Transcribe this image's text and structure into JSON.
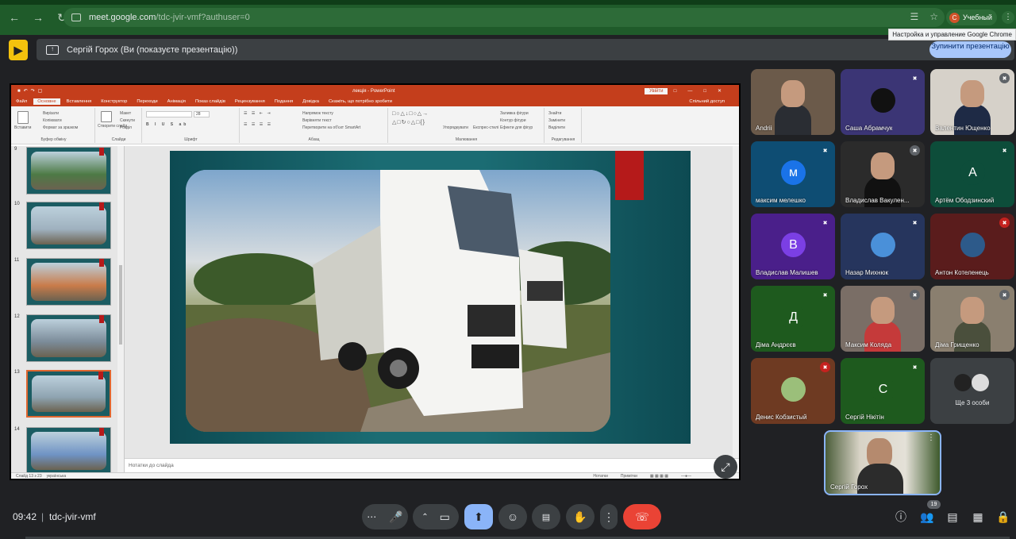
{
  "browser": {
    "url_domain": "meet.google.com",
    "url_path": "/tdc-jvir-vmf?authuser=0",
    "profile_initial": "С",
    "profile_name": "Учебный",
    "tooltip": "Настройка и управление Google Chrome"
  },
  "banner": {
    "text": "Сергій Горох (Ви (показуєте презентацію))",
    "stop_button": "Зупинити презентацію"
  },
  "powerpoint": {
    "window_title": "лекція - PowerPoint",
    "login_button": "Увійти",
    "menu": [
      "Файл",
      "Основне",
      "Вставлення",
      "Конструктор",
      "Переходи",
      "Анімація",
      "Показ слайдів",
      "Рецензування",
      "Подання",
      "Довідка"
    ],
    "active_menu": "Основне",
    "tell_me": "Скажіть, що потрібно зробити",
    "share": "Спільний доступ",
    "ribbon": {
      "clipboard": {
        "paste": "Вставити",
        "cut": "Вирізати",
        "copy": "Копіювати",
        "format": "Формат за зразком",
        "label": "Буфер обміну"
      },
      "slides": {
        "new": "Створити слайд",
        "layout": "Макет",
        "reset": "Скинути",
        "section": "Розділ",
        "label": "Слайди"
      },
      "font": {
        "label": "Шрифт",
        "size": "28"
      },
      "paragraph": {
        "label": "Абзац",
        "dir": "Напрямок тексту",
        "align": "Вирівняти текст",
        "smartart": "Перетворити на об'єкт SmartArt"
      },
      "drawing": {
        "arrange": "Упорядкувати",
        "styles": "Експрес-стилі",
        "fill": "Заливка фігури",
        "outline": "Контур фігури",
        "effects": "Ефекти для фігур",
        "label": "Малювання"
      },
      "editing": {
        "find": "Знайти",
        "replace": "Замінити",
        "select": "Виділити",
        "label": "Редагування"
      }
    },
    "thumbnails": [
      {
        "num": "9",
        "selected": false,
        "color": "#4d7a45"
      },
      {
        "num": "10",
        "selected": false,
        "color": "#9fb1bf"
      },
      {
        "num": "11",
        "selected": false,
        "color": "#c97b4a"
      },
      {
        "num": "12",
        "selected": false,
        "color": "#7b8b99"
      },
      {
        "num": "13",
        "selected": true,
        "color": "#8ea3b0"
      },
      {
        "num": "14",
        "selected": false,
        "color": "#6f93c4"
      }
    ],
    "notes_placeholder": "Нотатки до слайда",
    "status": {
      "slide": "Слайд 13 з 23",
      "language": "українська",
      "notes": "Нотатки",
      "comments": "Примітки"
    }
  },
  "participants": [
    {
      "name": "Andrii",
      "type": "video",
      "bg": "#6b5a4a",
      "body": "#2a2d33",
      "muted": false
    },
    {
      "name": "Саша Абрамчук",
      "type": "avatar-photo",
      "bg": "#3b3575",
      "avatar_bg": "#111",
      "muted": true,
      "mute_color": "#3b3575"
    },
    {
      "name": "Валентин Ющенко",
      "type": "video",
      "bg": "#d6d1c9",
      "body": "#1e2a45",
      "muted": true,
      "mute_color": "#5f6368"
    },
    {
      "name": "максим мелешко",
      "type": "initial",
      "initial": "м",
      "bg": "#0e4d73",
      "avatar_bg": "#1a73e8",
      "muted": true,
      "mute_color": "#0e4d73"
    },
    {
      "name": "Владислав Вакулен...",
      "type": "video",
      "bg": "#2b2b2b",
      "body": "#111",
      "muted": true,
      "mute_color": "#5f6368"
    },
    {
      "name": "Артём Ободзинский",
      "type": "initial",
      "initial": "А",
      "bg": "#0d4d3a",
      "avatar_bg": "#0d4d3a",
      "muted": true,
      "mute_color": "#0d4d3a"
    },
    {
      "name": "Владислав Малишев",
      "type": "initial",
      "initial": "В",
      "bg": "#4a1f8a",
      "avatar_bg": "#7b3fe4",
      "muted": true,
      "mute_color": "#4a1f8a"
    },
    {
      "name": "Назар Михнюк",
      "type": "avatar-photo",
      "bg": "#26355d",
      "avatar_bg": "#4a90d9",
      "muted": true,
      "mute_color": "#26355d"
    },
    {
      "name": "Антон Котеленець",
      "type": "avatar-photo",
      "bg": "#5a1c1c",
      "avatar_bg": "#2d5a8a",
      "muted": true,
      "mute_color": "#c5221f"
    },
    {
      "name": "Діма Андрєєв",
      "type": "initial",
      "initial": "Д",
      "bg": "#1e5a1e",
      "avatar_bg": "#1e5a1e",
      "muted": true,
      "mute_color": "#1e5a1e"
    },
    {
      "name": "Максим Коляда",
      "type": "video",
      "bg": "#7a6e66",
      "body": "#c53a3a",
      "muted": true,
      "mute_color": "#5f6368"
    },
    {
      "name": "Діма Грищенко",
      "type": "video",
      "bg": "#8a7f6f",
      "body": "#4a4f3c",
      "muted": true,
      "mute_color": "#5f6368"
    },
    {
      "name": "Денис Кобзистый",
      "type": "avatar-photo",
      "bg": "#6e3a22",
      "avatar_bg": "#9bbf7a",
      "muted": true,
      "mute_color": "#c5221f"
    },
    {
      "name": "Сергій Нікітін",
      "type": "initial",
      "initial": "С",
      "bg": "#1e5a1e",
      "avatar_bg": "#1e5a1e",
      "muted": true,
      "mute_color": "#1e5a1e"
    }
  ],
  "others": {
    "label": "Ще 3 особи"
  },
  "self": {
    "name": "Сергій Горох"
  },
  "bottom_bar": {
    "time": "09:42",
    "separator": "|",
    "meeting_code": "tdc-jvir-vmf",
    "participant_count": "19"
  }
}
